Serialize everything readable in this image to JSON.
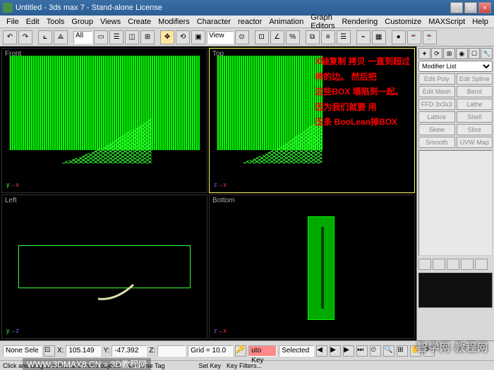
{
  "window": {
    "title": "Untitled - 3ds max 7 - Stand-alone License"
  },
  "menu": [
    "File",
    "Edit",
    "Tools",
    "Group",
    "Views",
    "Create",
    "Modifiers",
    "Character",
    "reactor",
    "Animation",
    "Graph Editors",
    "Rendering",
    "Customize",
    "MAXScript",
    "Help"
  ],
  "toolbar": {
    "selector": "All",
    "view": "View"
  },
  "viewports": {
    "front": "Front",
    "top": "Top",
    "left": "Left",
    "bottom": "Bottom"
  },
  "annotation": {
    "l1": "X轴复制 拷贝 一直到超过",
    "l2": "榉的边。 然后把",
    "l3": "这些BOX 塌陷到一起。",
    "l4": "因为我们就要 用",
    "l5": "压条 BooLean掉BOX"
  },
  "panel": {
    "modifier_label": "Modifier List",
    "btns": [
      "Edit Poly",
      "Edit Spline",
      "Edit Mesh",
      "Bend",
      "FFD 3x3x3",
      "Lathe",
      "Lattice",
      "Shell",
      "Skew",
      "Slice",
      "Smooth",
      "UVW Map"
    ]
  },
  "status": {
    "selection": "None Sele",
    "x_label": "X:",
    "x": "105.149",
    "y_label": "Y:",
    "y": "-47.392",
    "z_label": "Z:",
    "z": "",
    "grid": "Grid = 10.0",
    "autokey": "uto Key",
    "selected": "Selected",
    "setkey": "Set Key",
    "keyfilters": "Key Filters..."
  },
  "footer": {
    "hint": "Click and drag to select and move objects",
    "timetag": "Add Time Tag"
  },
  "watermark": {
    "right": "智学网 教程网",
    "left": "WWW.3DMAX8.CN » 3D教程网"
  }
}
